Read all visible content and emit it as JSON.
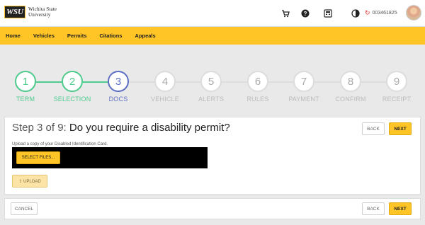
{
  "header": {
    "logo_mark": "WSU",
    "university_line1": "Wichita State",
    "university_line2": "University",
    "user_id": "003461825",
    "icons": [
      "cart-icon",
      "help-icon",
      "calculator-icon",
      "contrast-icon",
      "refresh-icon"
    ]
  },
  "nav": {
    "items": [
      "Home",
      "Vehicles",
      "Permits",
      "Citations",
      "Appeals"
    ]
  },
  "stepper": {
    "current": 3,
    "steps": [
      {
        "num": "1",
        "label": "TERM",
        "state": "done"
      },
      {
        "num": "2",
        "label": "SELECTION",
        "state": "done"
      },
      {
        "num": "3",
        "label": "DOCS",
        "state": "current"
      },
      {
        "num": "4",
        "label": "VEHICLE",
        "state": "pending"
      },
      {
        "num": "5",
        "label": "ALERTS",
        "state": "pending"
      },
      {
        "num": "6",
        "label": "RULES",
        "state": "pending"
      },
      {
        "num": "7",
        "label": "PAYMENT",
        "state": "pending"
      },
      {
        "num": "8",
        "label": "CONFIRM",
        "state": "pending"
      },
      {
        "num": "9",
        "label": "RECEIPT",
        "state": "pending"
      }
    ]
  },
  "main": {
    "step_text": "Step 3 of 9:",
    "question": "Do you require a disability permit?",
    "upload_label": "Upload a copy of your Disabled Identification Card.",
    "select_files": "SELECT FILES...",
    "upload_button": "⇪ UPLOAD",
    "back": "BACK",
    "next": "NEXT"
  },
  "footer": {
    "cancel": "CANCEL",
    "back": "BACK",
    "next": "NEXT"
  },
  "colors": {
    "brand_yellow": "#ffc425",
    "done_green": "#4ecb8d",
    "current_blue": "#5b6ec4",
    "pending_grey": "#dcdcdc"
  }
}
